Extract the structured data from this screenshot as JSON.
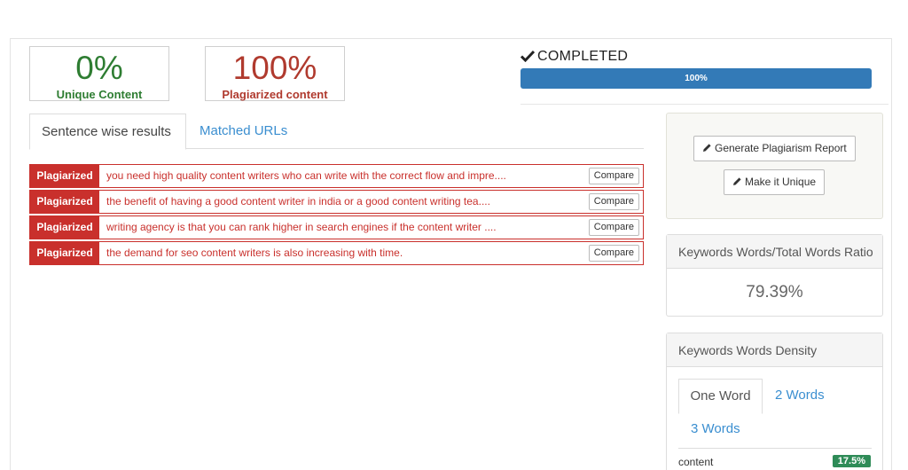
{
  "stats": {
    "unique": {
      "percent": "0%",
      "label": "Unique Content"
    },
    "plagiarized": {
      "percent": "100%",
      "label": "Plagiarized content"
    }
  },
  "status": {
    "text": "COMPLETED",
    "progress_label": "100%",
    "progress": 1.0
  },
  "tabs": [
    {
      "label": "Sentence wise results",
      "active": true
    },
    {
      "label": "Matched URLs",
      "active": false
    }
  ],
  "results": [
    {
      "badge": "Plagiarized",
      "text": "you need high quality content writers who can write with the correct flow and impre....",
      "button": "Compare"
    },
    {
      "badge": "Plagiarized",
      "text": "the benefit of having a good content writer in india or a good content writing tea....",
      "button": "Compare"
    },
    {
      "badge": "Plagiarized",
      "text": "writing agency is that you can rank higher in search engines if the content writer ....",
      "button": "Compare"
    },
    {
      "badge": "Plagiarized",
      "text": "the demand for seo content writers is also increasing with time.",
      "button": "Compare"
    }
  ],
  "actions": {
    "report_label": "Generate Plagiarism Report",
    "unique_label": "Make it Unique"
  },
  "ratio": {
    "title": "Keywords Words/Total Words Ratio",
    "value": "79.39%"
  },
  "density": {
    "title": "Keywords Words Density",
    "tabs": [
      "One Word",
      "2 Words",
      "3 Words"
    ],
    "rows": [
      {
        "keyword": "content",
        "percent": "17.5%"
      }
    ]
  },
  "colors": {
    "unique": "#2e7d32",
    "plagiarized": "#b03a2e",
    "badge_red": "#c9302c",
    "progress_blue": "#337ab7",
    "link_blue": "#3a8ed0",
    "density_green": "#2e8b57"
  },
  "icons": {
    "status": "check-icon",
    "report": "pencil-icon",
    "unique": "pencil-icon"
  }
}
